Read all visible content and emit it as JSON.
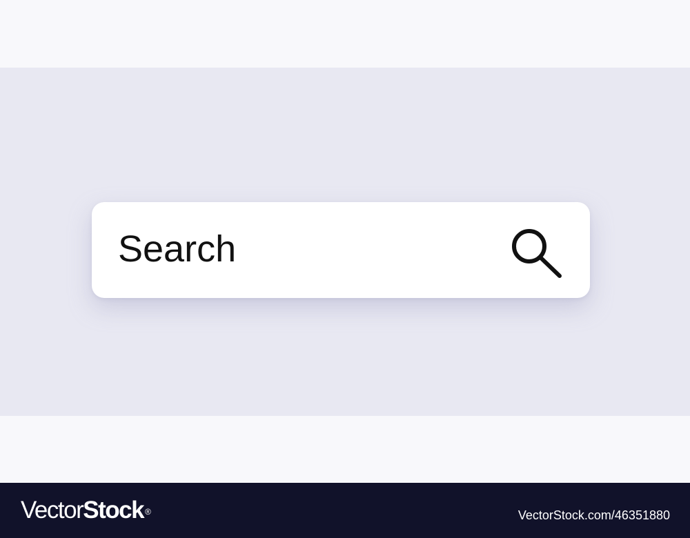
{
  "search": {
    "placeholder": "Search",
    "icon": "magnifier-icon"
  },
  "colors": {
    "stage_background": "#e8e8f2",
    "page_margin": "#f8f8fb",
    "search_bar": "#ffffff",
    "text": "#111111",
    "footer": "#11122a"
  },
  "watermark": {
    "brand_light": "Vector",
    "brand_bold": "Stock",
    "registered_mark": "®",
    "image_id": "VectorStock.com/46351880"
  }
}
